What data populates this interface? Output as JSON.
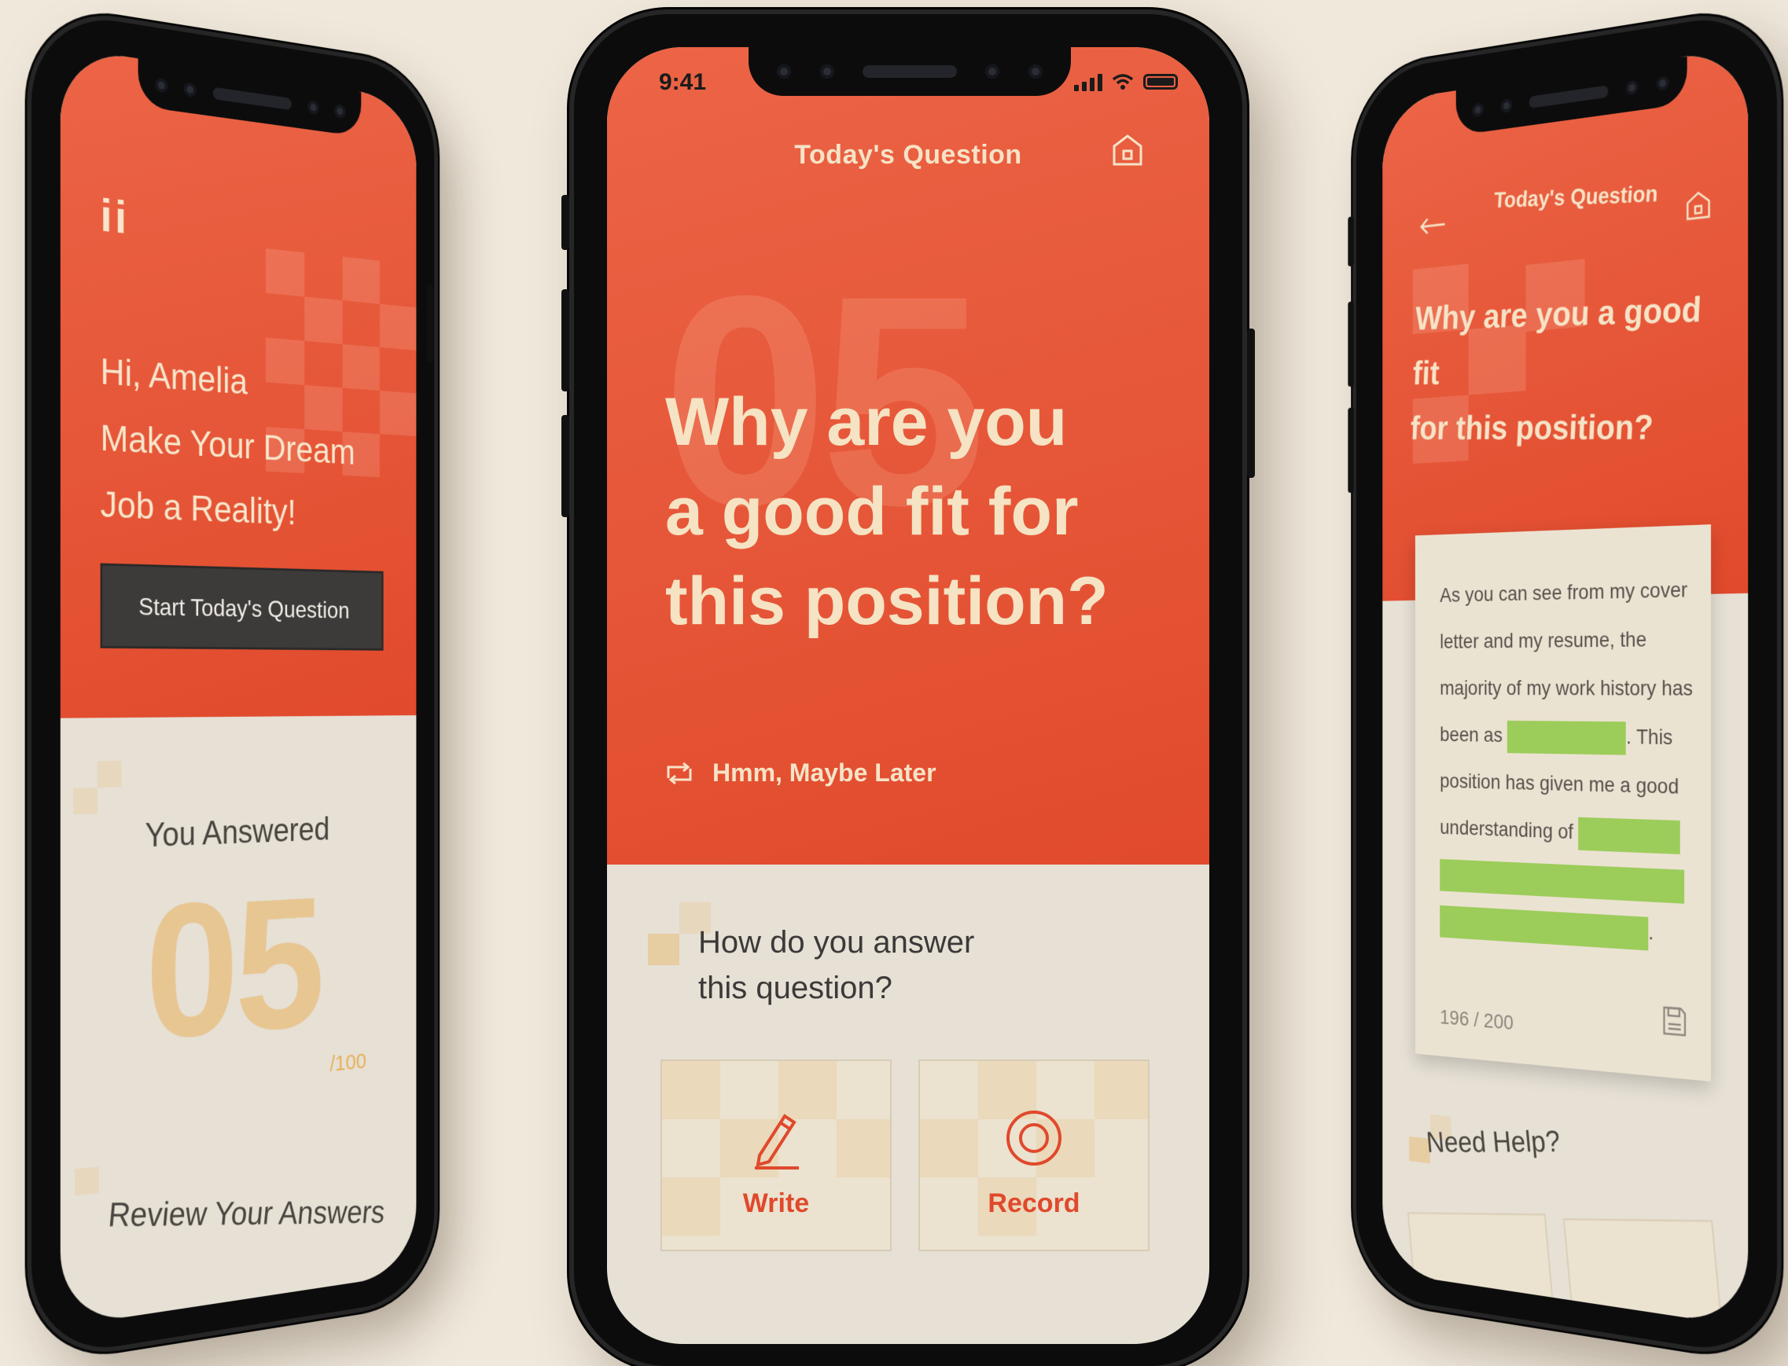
{
  "colors": {
    "accent": "#e14a2c",
    "cream": "#f5e3c3",
    "gold": "#e7b15b",
    "highlight": "#9ccc5a"
  },
  "left_screen": {
    "logo": "ii",
    "greeting_lines": [
      "Hi, Amelia",
      "Make Your Dream",
      "Job a Reality!"
    ],
    "start_button": "Start Today's Question",
    "answered_label": "You Answered",
    "answered_count": "05",
    "answered_total": "/100",
    "review_label": "Review Your Answers"
  },
  "center_screen": {
    "status_time": "9:41",
    "header_title": "Today's Question",
    "question_number": "05",
    "question_lines": [
      "Why are you",
      "a good fit for",
      "this position?"
    ],
    "later_link": "Hmm, Maybe Later",
    "answer_prompt_lines": [
      "How do you answer",
      "this question?"
    ],
    "options": [
      {
        "label": "Write",
        "icon": "pencil-icon"
      },
      {
        "label": "Record",
        "icon": "record-icon"
      }
    ]
  },
  "right_screen": {
    "header_title": "Today's Question",
    "question_lines": [
      "Why are you a good fit",
      "for this position?"
    ],
    "answer_parts": [
      "As you can see from my cover letter and my resume, the majority of my work history has been as",
      ". This position has given me a good understanding of",
      "."
    ],
    "char_count": "196 / 200",
    "help_label": "Need Help?"
  }
}
